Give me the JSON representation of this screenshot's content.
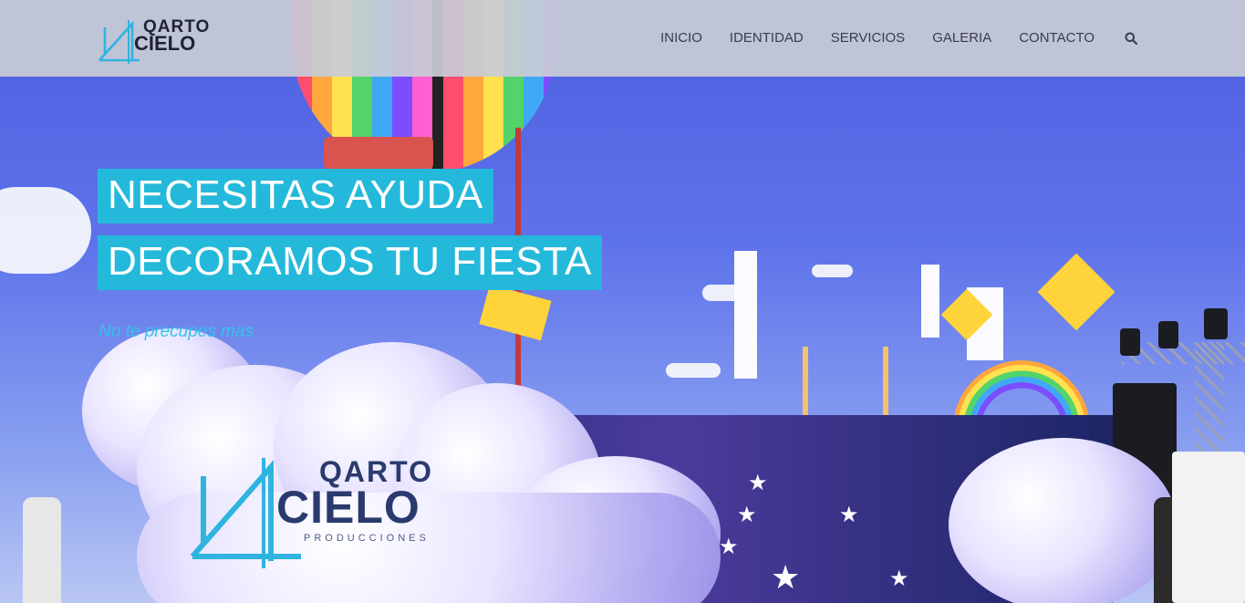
{
  "brand": {
    "name_top": "QARTO",
    "name_bottom": "CIELO"
  },
  "nav": {
    "items": [
      "INICIO",
      "IDENTIDAD",
      "SERVICIOS",
      "GALERIA",
      "CONTACTO"
    ],
    "search_icon": "search-icon"
  },
  "hero": {
    "headline_line1": "NECESITAS AYUDA",
    "headline_line2": "DECORAMOS TU FIESTA",
    "tagline": "No te precupes mas"
  },
  "watermark": {
    "top": "QARTO",
    "bottom": "CIELO",
    "sub": "PRODUCCIONES"
  },
  "colors": {
    "accent": "#24b9da",
    "tagline": "#33c3e6",
    "navbar": "#c8cbd6",
    "nav_text": "#3a3d4a"
  }
}
